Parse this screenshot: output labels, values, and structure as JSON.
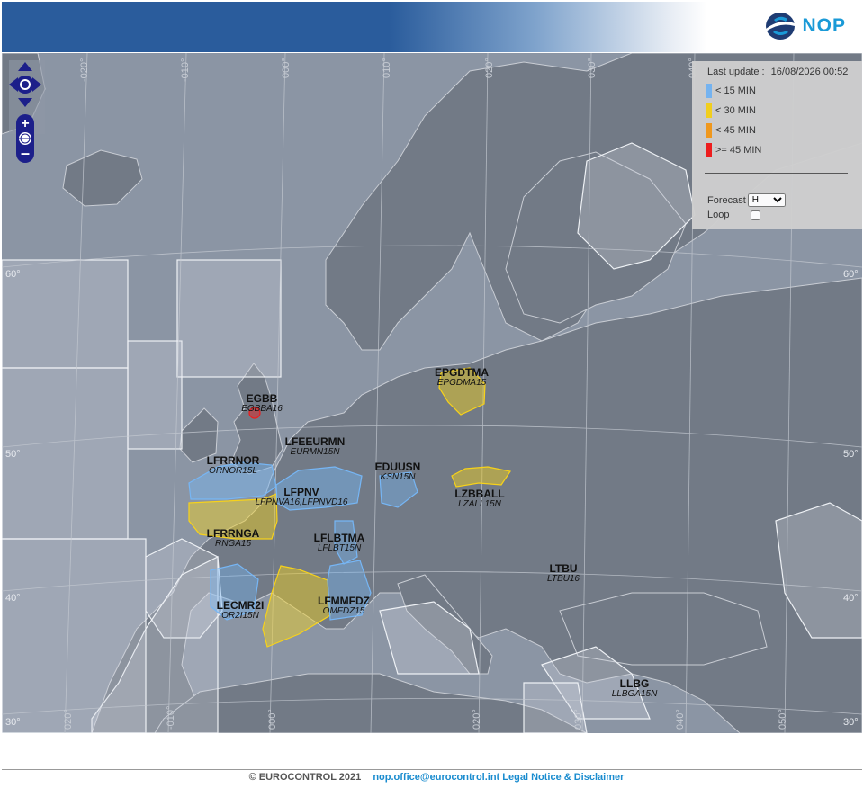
{
  "header": {
    "logo_text": "NOP"
  },
  "legend": {
    "last_update_label": "Last update :",
    "last_update_value": "16/08/2026 00:52",
    "items": [
      {
        "label": "< 15 MIN",
        "color": "#76b6f5"
      },
      {
        "label": "< 30 MIN",
        "color": "#f7d21a"
      },
      {
        "label": "< 45 MIN",
        "color": "#f59a1a"
      },
      {
        "label": ">= 45 MIN",
        "color": "#f21a1a"
      }
    ],
    "forecast_label": "Forecast",
    "forecast_value": "H",
    "loop_label": "Loop"
  },
  "map": {
    "lat_labels": [
      "60°",
      "50°",
      "40°",
      "30°",
      "60°",
      "50°",
      "40°",
      "30°"
    ],
    "lon_labels": [
      "-020°",
      "-010°",
      "000°",
      "010°",
      "020°",
      "030°",
      "040°",
      "020°",
      "-010°",
      "000°",
      "020°",
      "030°",
      "040°",
      "050°"
    ],
    "sectors": [
      {
        "name": "EPGDTMA",
        "code": "EPGDMA15",
        "delay": "< 30 MIN"
      },
      {
        "name": "EGBB",
        "code": "EGBBA16",
        "delay": ">= 45 MIN"
      },
      {
        "name": "LFEEURMN",
        "code": "EURMN15N",
        "delay": "< 15 MIN"
      },
      {
        "name": "LFRRNOR",
        "code": "ORNOR15L",
        "delay": "< 15 MIN"
      },
      {
        "name": "EDUUSN",
        "code": "KSN15N",
        "delay": "< 15 MIN"
      },
      {
        "name": "LFPNV",
        "code": "LFPNVA16,LFPNVD16",
        "delay": "< 30 MIN"
      },
      {
        "name": "LZBBALL",
        "code": "LZALL15N",
        "delay": "< 30 MIN"
      },
      {
        "name": "LFRRNGA",
        "code": "RNGA15",
        "delay": "< 30 MIN"
      },
      {
        "name": "LFLBTMA",
        "code": "LFLBT15N",
        "delay": "< 15 MIN"
      },
      {
        "name": "LTBU",
        "code": "LTBU16",
        "delay": ""
      },
      {
        "name": "LECMR2I",
        "code": "OR2I15N",
        "delay": "< 15 MIN"
      },
      {
        "name": "LFMMFDZ",
        "code": "OMFDZ15",
        "delay": "< 30 MIN"
      },
      {
        "name": "LLBG",
        "code": "LLBGA15N",
        "delay": ""
      }
    ]
  },
  "footer": {
    "copyright": "© EUROCONTROL 2021",
    "email": "nop.office@eurocontrol.int",
    "legal": "Legal Notice & Disclaimer"
  }
}
